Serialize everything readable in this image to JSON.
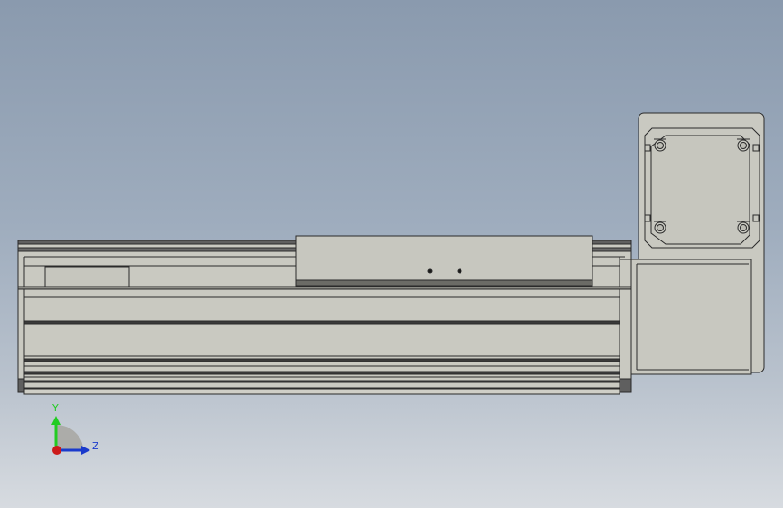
{
  "viewport": {
    "background_top": "#8a9aae",
    "background_bottom": "#d7dbe0",
    "part_color": "#c8c8c0",
    "edge_color": "#2a2a2a",
    "dark_strip_color": "#5f5f5f"
  },
  "triad": {
    "y_label": "Y",
    "z_label": "Z",
    "y_color": "#22cc22",
    "z_color": "#1a3acc",
    "x_color": "#cc1a1a"
  }
}
